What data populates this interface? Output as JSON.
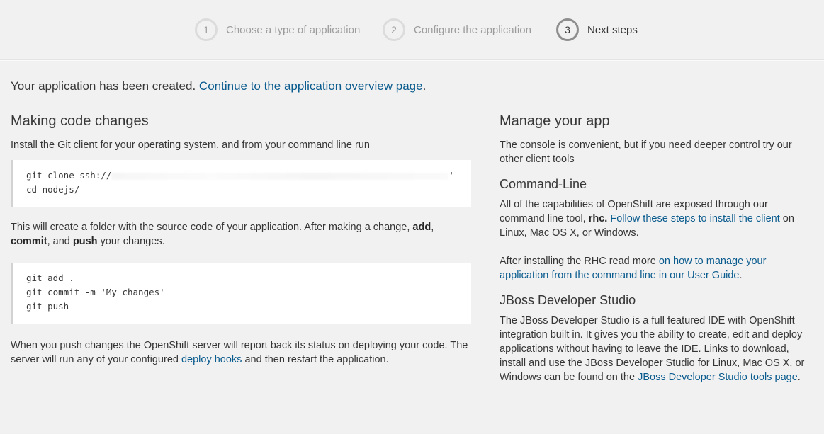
{
  "steps": [
    {
      "number": "1",
      "label": "Choose a type of application",
      "active": false
    },
    {
      "number": "2",
      "label": "Configure the application",
      "active": false
    },
    {
      "number": "3",
      "label": "Next steps",
      "active": true
    }
  ],
  "created": {
    "text": "Your application has been created.",
    "link": "Continue to the application overview page",
    "suffix": "."
  },
  "left": {
    "heading": "Making code changes",
    "intro": "Install the Git client for your operating system, and from your command line run",
    "clone_code": {
      "line1_prefix": "git clone ssh://",
      "line1_suffix": "'",
      "line2": "cd nodejs/"
    },
    "after_clone": {
      "part1": "This will create a folder with the source code of your application. After making a change,",
      "add": "add",
      "sep": ",",
      "commit": "commit",
      "and": ", and",
      "push": "push",
      "part2": "your changes."
    },
    "push_code": [
      "git add .",
      "git commit -m 'My changes'",
      "git push"
    ],
    "after_push": {
      "part1": "When you push changes the OpenShift server will report back its status on deploying your code. The server will run any of your configured",
      "link": "deploy hooks",
      "part2": "and then restart the application."
    }
  },
  "right": {
    "heading": "Manage your app",
    "intro": "The console is convenient, but if you need deeper control try our other client tools",
    "cli": {
      "heading": "Command-Line",
      "p1_part1": "All of the capabilities of OpenShift are exposed through our command line tool,",
      "p1_bold": "rhc.",
      "p1_link": "Follow these steps to install the client",
      "p1_part2": "on Linux, Mac OS X, or Windows.",
      "p2_part1": "After installing the RHC read more",
      "p2_link": "on how to manage your application from the command line in our User Guide",
      "p2_suffix": "."
    },
    "jboss": {
      "heading": "JBoss Developer Studio",
      "part1": "The JBoss Developer Studio is a full featured IDE with OpenShift integration built in. It gives you the ability to create, edit and deploy applications without having to leave the IDE. Links to download, install and use the JBoss Developer Studio for Linux, Mac OS X, or Windows can be found on the",
      "link": "JBoss Developer Studio tools page",
      "suffix": "."
    }
  }
}
